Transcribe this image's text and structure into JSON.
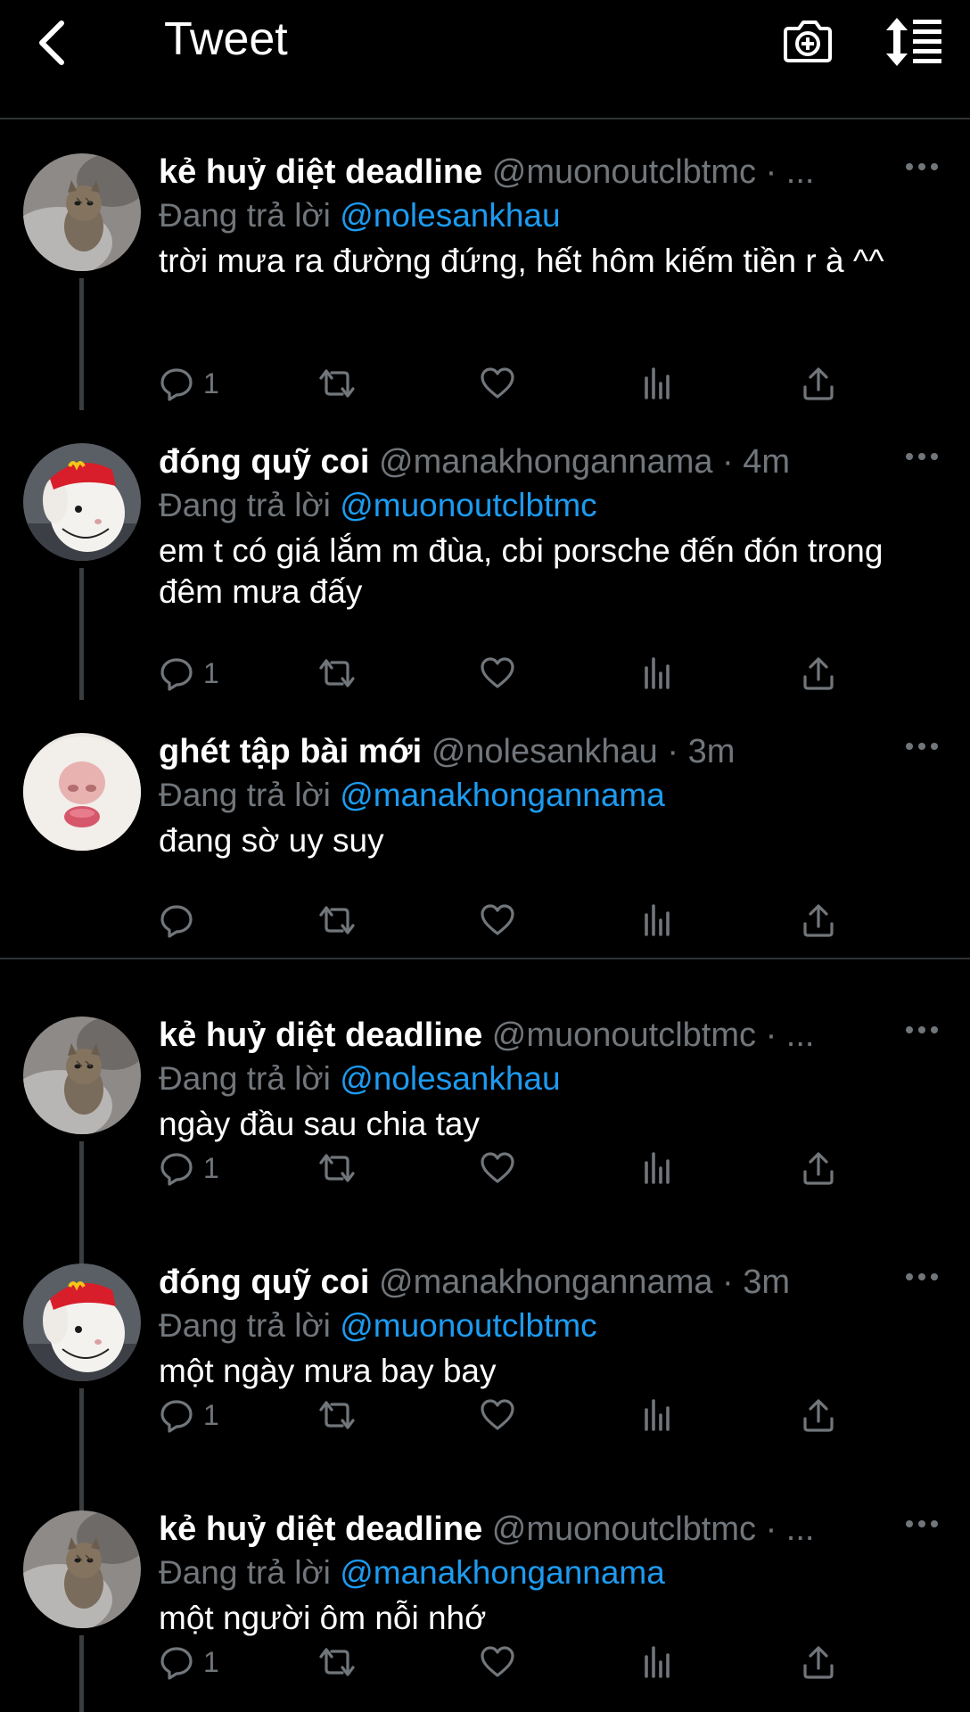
{
  "header": {
    "title": "Tweet",
    "back_icon": "chevron-left-icon",
    "camera_icon": "camera-add-icon",
    "sort_icon": "sort-list-icon"
  },
  "colors": {
    "background": "#000000",
    "text": "#ffffff",
    "muted": "#71767b",
    "link": "#1d9bf0",
    "line": "#2f3336"
  },
  "tweets": [
    {
      "name": "kẻ huỷ diệt deadline",
      "handle": "@muonoutclbtmc · ...",
      "reply_prefix": "Đang trả lời ",
      "reply_to": "@nolesankhau",
      "text": "trời mưa ra đường đứng, hết hôm kiếm tiền r à ^^",
      "reply_count": "1",
      "avatar": "cat"
    },
    {
      "name": "đóng quỹ coi",
      "handle": "@manakhongannama · 4m",
      "reply_prefix": "Đang trả lời ",
      "reply_to": "@muonoutclbtmc",
      "text": "em t có giá lắm m đùa, cbi porsche đến đón trong đêm mưa đấy",
      "reply_count": "1",
      "avatar": "rabbit"
    },
    {
      "name": "ghét tập bài mới",
      "handle": "@nolesankhau · 3m",
      "reply_prefix": "Đang trả lời ",
      "reply_to": "@manakhongannama",
      "text": "đang sờ uy suy",
      "reply_count": "",
      "avatar": "nose"
    },
    {
      "name": "kẻ huỷ diệt deadline",
      "handle": "@muonoutclbtmc · ...",
      "reply_prefix": "Đang trả lời ",
      "reply_to": "@nolesankhau",
      "text": "ngày đầu sau chia tay",
      "reply_count": "1",
      "avatar": "cat"
    },
    {
      "name": "đóng quỹ coi",
      "handle": "@manakhongannama · 3m",
      "reply_prefix": "Đang trả lời ",
      "reply_to": "@muonoutclbtmc",
      "text": "một ngày mưa bay bay",
      "reply_count": "1",
      "avatar": "rabbit"
    },
    {
      "name": "kẻ huỷ diệt deadline",
      "handle": "@muonoutclbtmc · ...",
      "reply_prefix": "Đang trả lời ",
      "reply_to": "@manakhongannama",
      "text": "một người ôm nỗi nhớ",
      "reply_count": "1",
      "avatar": "cat"
    }
  ]
}
